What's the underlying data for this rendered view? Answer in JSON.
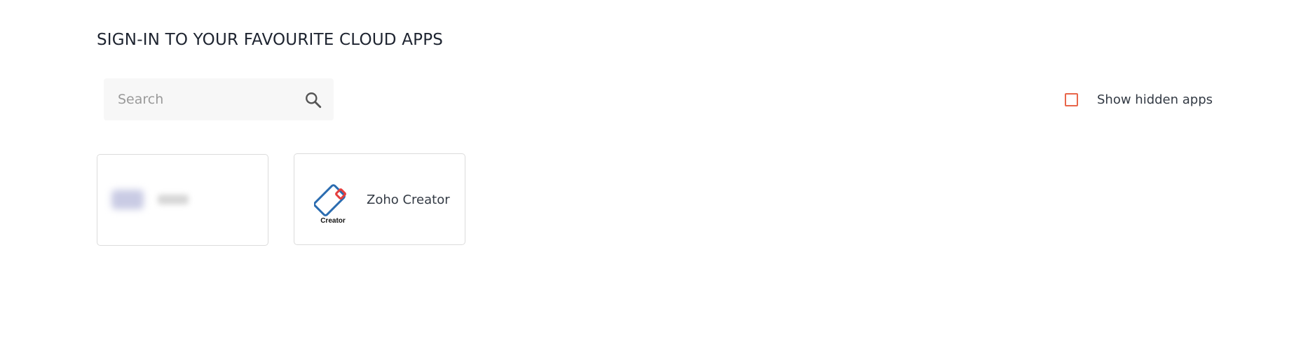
{
  "page": {
    "title": "SIGN-IN TO YOUR FAVOURITE CLOUD APPS"
  },
  "search": {
    "placeholder": "Search",
    "value": "",
    "icon": "search-icon"
  },
  "filters": {
    "show_hidden_label": "Show hidden apps",
    "show_hidden_checked": false,
    "accent_color": "#e8664a"
  },
  "apps": [
    {
      "name": "",
      "redacted": true
    },
    {
      "name": "Zoho Creator",
      "logo_label": "Creator",
      "logo_icon": "zoho-creator-icon",
      "logo_colors": [
        "#2b6cb0",
        "#e53e3e"
      ]
    }
  ]
}
